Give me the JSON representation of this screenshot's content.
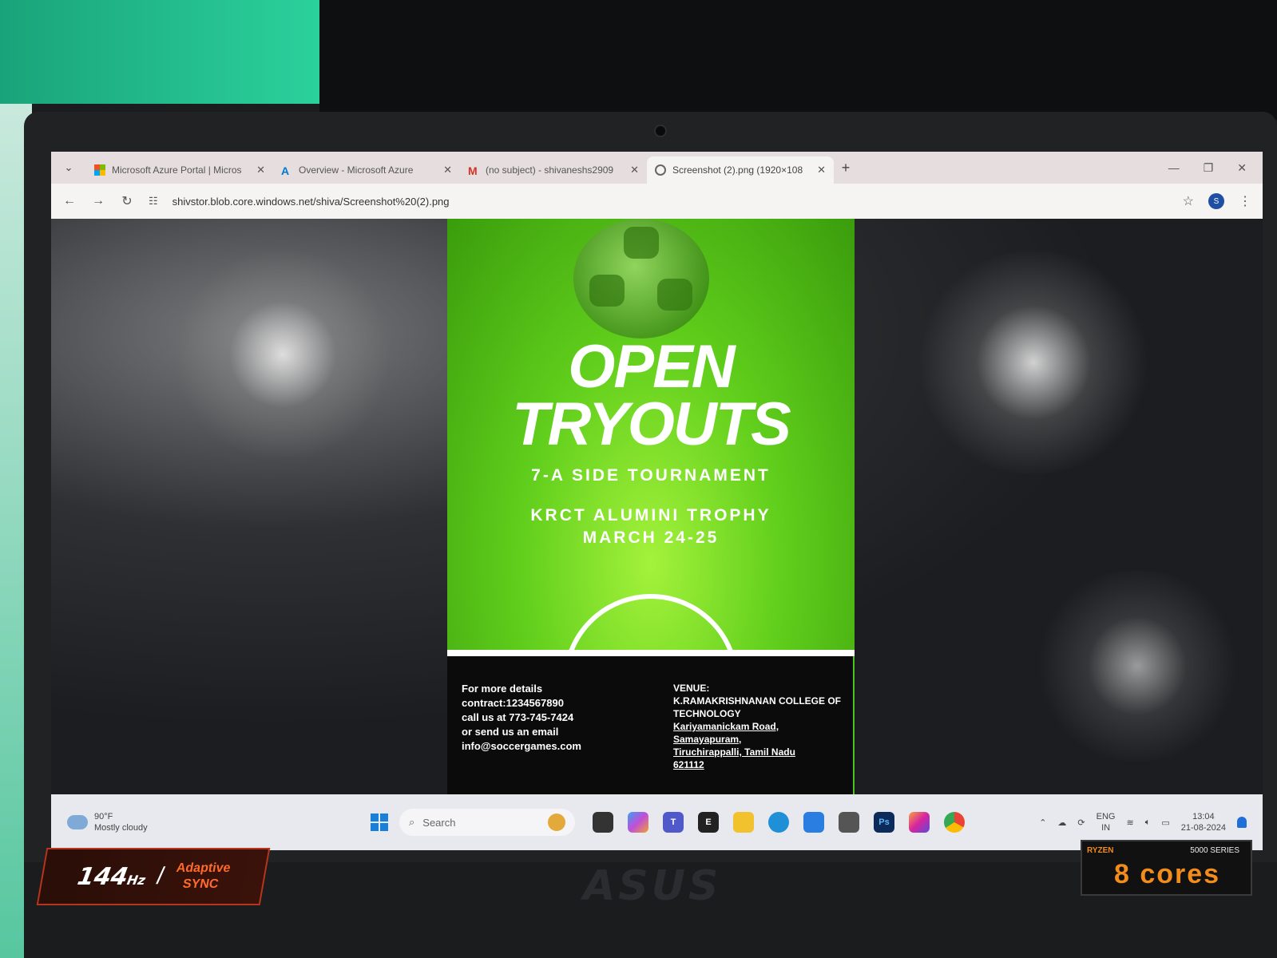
{
  "browser": {
    "tabs": [
      {
        "title": "Microsoft Azure Portal | Micros",
        "icon": "microsoft-icon"
      },
      {
        "title": "Overview - Microsoft Azure",
        "icon": "azure-icon"
      },
      {
        "title": "(no subject) - shivaneshs2909",
        "icon": "gmail-icon"
      },
      {
        "title": "Screenshot (2).png (1920×108",
        "icon": "globe-icon",
        "active": true
      }
    ],
    "url": "shivstor.blob.core.windows.net/shiva/Screenshot%20(2).png"
  },
  "poster": {
    "title_line1": "OPEN",
    "title_line2": "TRYOUTS",
    "subtitle": "7-A SIDE TOURNAMENT",
    "trophy": "KRCT ALUMINI TROPHY",
    "dates": "MARCH 24-25",
    "contact": {
      "line1": "For more details",
      "line2": "contract:1234567890",
      "line3": "call us at 773-745-7424",
      "line4": "or send us an email",
      "line5": "info@soccergames.com"
    },
    "venue": {
      "label": "VENUE:",
      "line1": "K.RAMAKRISHNANAN COLLEGE OF TECHNOLOGY",
      "line2": "Kariyamanickam Road,",
      "line3": "Samayapuram,",
      "line4": "Tiruchirappalli, Tamil Nadu",
      "line5": "621112"
    }
  },
  "taskbar": {
    "weather_temp": "90°F",
    "weather_desc": "Mostly cloudy",
    "search_placeholder": "Search",
    "lang_line1": "ENG",
    "lang_line2": "IN",
    "time": "13:04",
    "date": "21-08-2024"
  },
  "laptop": {
    "refresh_rate": "144",
    "refresh_unit": "Hz",
    "adaptive_line1": "Adaptive",
    "adaptive_line2": "SYNC",
    "brand": "ASUS",
    "ryzen_label": "RYZEN",
    "ryzen_series": "5000 SERIES",
    "ryzen_cores": "8 cores"
  }
}
